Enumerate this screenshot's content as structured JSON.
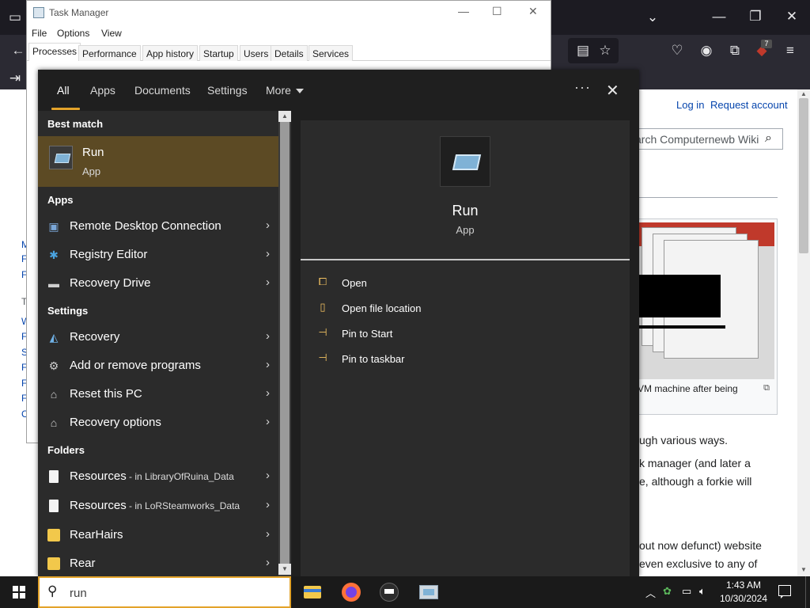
{
  "browser": {
    "account_links": {
      "login": "Log in",
      "request": "Request account"
    },
    "wiki_search_placeholder": "arch Computernewb Wiki",
    "thumb_caption": "VM machine after being",
    "text_lines": [
      "ugh various ways.",
      "k manager (and later a",
      "e, although a forkie will",
      "out now defunct) website",
      "even exclusive to any of"
    ],
    "sidebar_letters": [
      "M",
      "F",
      "F",
      "T",
      "W",
      "F",
      "S",
      "F",
      "F",
      "F",
      "C"
    ],
    "extension_badge": "7"
  },
  "task_manager": {
    "title": "Task Manager",
    "menu": [
      "File",
      "Options",
      "View"
    ],
    "tabs": [
      "Processes",
      "Performance",
      "App history",
      "Startup",
      "Users",
      "Details",
      "Services"
    ],
    "active_tab": "Processes"
  },
  "search": {
    "tabs": [
      "All",
      "Apps",
      "Documents",
      "Settings"
    ],
    "more_label": "More",
    "active_tab": "All",
    "query": "run",
    "sections": {
      "best_match": "Best match",
      "apps": "Apps",
      "settings": "Settings",
      "folders": "Folders"
    },
    "best_match": {
      "title": "Run",
      "subtitle": "App"
    },
    "apps": [
      {
        "label": "Remote Desktop Connection",
        "icon": "remote-desktop-icon"
      },
      {
        "label": "Registry Editor",
        "icon": "registry-editor-icon"
      },
      {
        "label": "Recovery Drive",
        "icon": "recovery-drive-icon"
      }
    ],
    "settings": [
      {
        "label": "Recovery",
        "icon": "recovery-icon"
      },
      {
        "label": "Add or remove programs",
        "icon": "gear-icon"
      },
      {
        "label": "Reset this PC",
        "icon": "reset-pc-icon"
      },
      {
        "label": "Recovery options",
        "icon": "recovery-options-icon"
      }
    ],
    "folders": [
      {
        "label": "Resources",
        "location": " - in LibraryOfRuina_Data",
        "icon": "file-icon"
      },
      {
        "label": "Resources",
        "location": " - in LoRSteamworks_Data",
        "icon": "file-icon"
      },
      {
        "label": "RearHairs",
        "location": "",
        "icon": "folder-icon"
      },
      {
        "label": "Rear",
        "location": "",
        "icon": "folder-icon"
      }
    ],
    "preview": {
      "title": "Run",
      "subtitle": "App",
      "actions": [
        {
          "label": "Open",
          "icon": "open-icon"
        },
        {
          "label": "Open file location",
          "icon": "file-location-icon"
        },
        {
          "label": "Pin to Start",
          "icon": "pin-icon"
        },
        {
          "label": "Pin to taskbar",
          "icon": "pin-icon"
        }
      ]
    },
    "accent": "#e3a32a"
  },
  "taskbar": {
    "clock_time": "1:43 AM",
    "clock_date": "10/30/2024",
    "apps": [
      "file-explorer-icon",
      "firefox-icon",
      "terminal-icon",
      "run-dialog-icon"
    ]
  }
}
